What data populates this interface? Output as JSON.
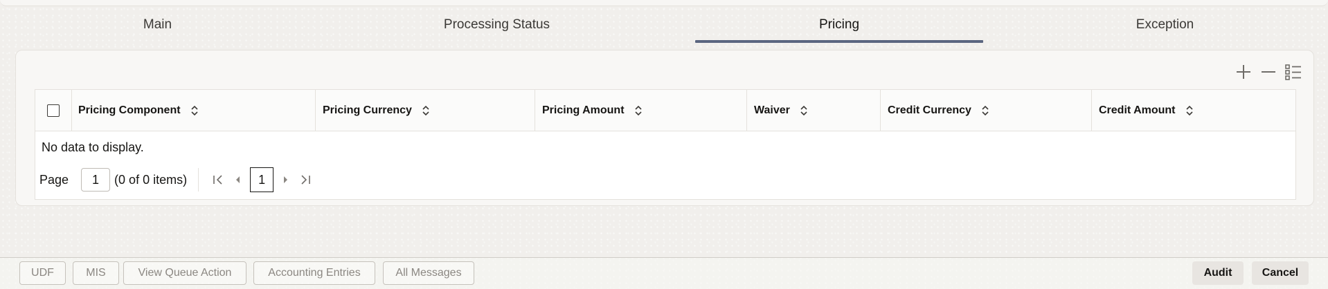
{
  "tabs": [
    {
      "label": "Main",
      "active": false
    },
    {
      "label": "Processing Status",
      "active": false
    },
    {
      "label": "Pricing",
      "active": true
    },
    {
      "label": "Exception",
      "active": false
    }
  ],
  "toolbar": {
    "icons": [
      "add-icon",
      "remove-icon",
      "column-list-icon"
    ]
  },
  "table": {
    "columns": [
      "Pricing Component",
      "Pricing Currency",
      "Pricing Amount",
      "Waiver",
      "Credit Currency",
      "Credit Amount"
    ],
    "empty_message": "No data to display.",
    "rows": []
  },
  "pager": {
    "page_label": "Page",
    "page_value": "1",
    "items_text": "(0 of 0 items)",
    "current_page": "1"
  },
  "footer": {
    "left_buttons": [
      "UDF",
      "MIS",
      "View Queue Action",
      "Accounting Entries",
      "All Messages"
    ],
    "right_buttons": [
      "Audit",
      "Cancel"
    ]
  },
  "colors": {
    "active_tab_underline": "#5b6680",
    "text": "#161513",
    "disabled_text": "#8b8782"
  }
}
